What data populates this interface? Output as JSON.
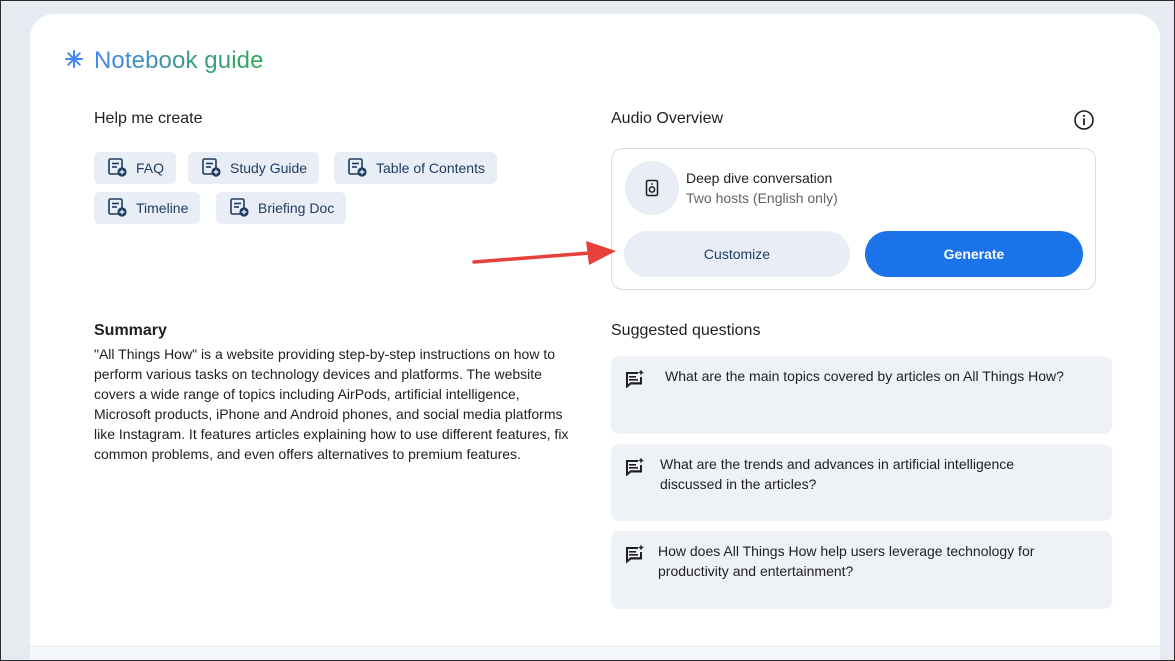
{
  "header": {
    "title": "Notebook guide",
    "icon": "sparkle-asterisk-icon"
  },
  "help_me_create": {
    "heading": "Help me create",
    "chips": [
      {
        "label": "FAQ",
        "icon": "note-add-icon"
      },
      {
        "label": "Study Guide",
        "icon": "note-add-icon"
      },
      {
        "label": "Table of Contents",
        "icon": "note-add-icon"
      },
      {
        "label": "Timeline",
        "icon": "note-add-icon"
      },
      {
        "label": "Briefing Doc",
        "icon": "note-add-icon"
      }
    ]
  },
  "summary": {
    "heading": "Summary",
    "text": "\"All Things How\" is a website providing step-by-step instructions on how to perform various tasks on technology devices and platforms. The website covers a wide range of topics including AirPods, artificial intelligence, Microsoft products, iPhone and Android phones, and social media platforms like Instagram. It features articles explaining how to use different features, fix common problems, and even offers alternatives to premium features."
  },
  "audio_overview": {
    "heading": "Audio Overview",
    "info_icon": "info-icon",
    "card": {
      "icon": "speaker-icon",
      "title": "Deep dive conversation",
      "subtitle": "Two hosts (English only)",
      "customize_label": "Customize",
      "generate_label": "Generate"
    }
  },
  "suggested_questions": {
    "heading": "Suggested questions",
    "items": [
      "What are the main topics covered by articles on All Things How?",
      "What are the trends and advances in artificial intelligence discussed in the articles?",
      "How does All Things How help users leverage technology for productivity and entertainment?"
    ]
  },
  "annotation": {
    "arrow_color": "#e8403a"
  },
  "colors": {
    "accent_blue": "#1a73e8",
    "chip_bg": "#e9eef6",
    "question_bg": "#eef1f6"
  }
}
